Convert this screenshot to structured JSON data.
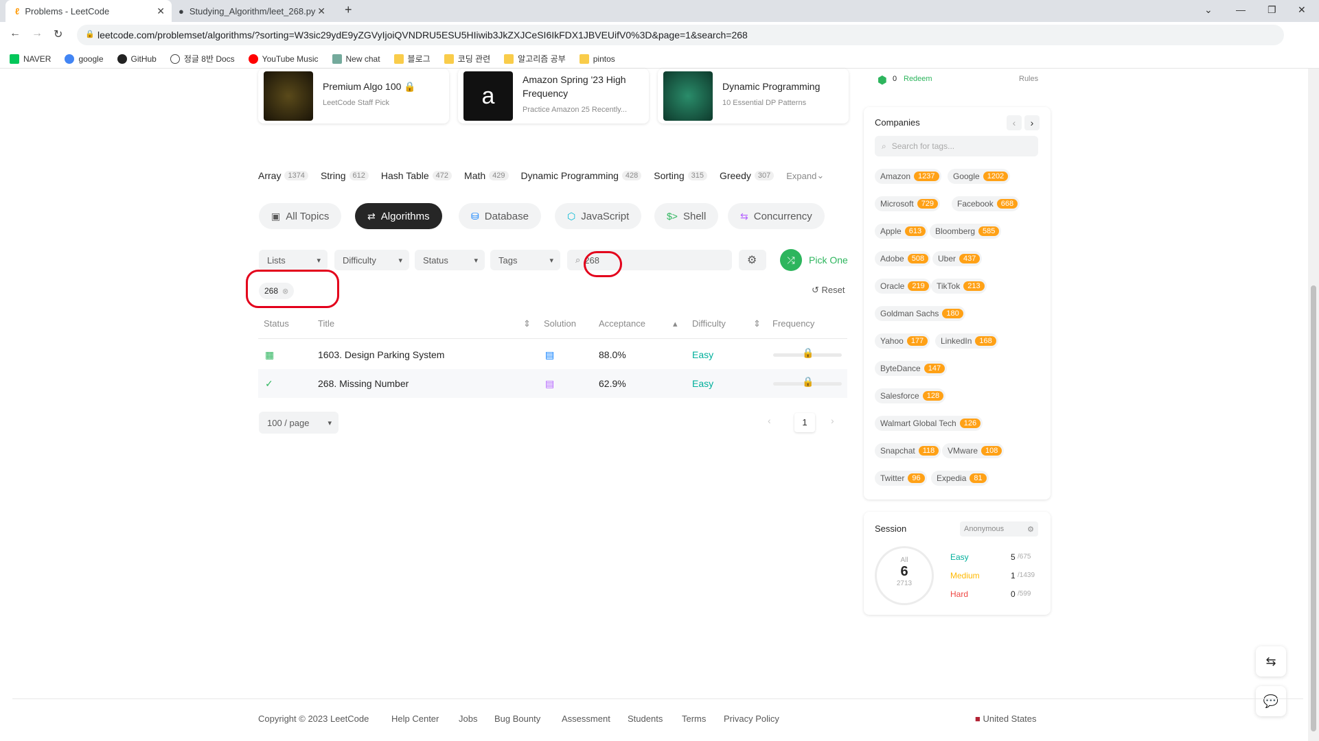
{
  "browser": {
    "tabs": [
      {
        "title": "Problems - LeetCode"
      },
      {
        "title": "Studying_Algorithm/leet_268.py"
      }
    ],
    "url": "leetcode.com/problemset/algorithms/?sorting=W3sic29ydE9yZGVyIjoiQVNDRU5ESU5HIiwib3JkZXJCeSI6IkFDX1JBVEUifV0%3D&page=1&search=268",
    "bookmarks": [
      "NAVER",
      "google",
      "GitHub",
      "정글 8반 Docs",
      "YouTube Music",
      "New chat",
      "블로그",
      "코딩 관련",
      "알고리즘 공부",
      "pintos"
    ]
  },
  "featured": [
    {
      "title": "Premium Algo 100",
      "sub": "LeetCode Staff Pick"
    },
    {
      "title": "Amazon Spring '23 High Frequency",
      "sub": "Practice Amazon 25 Recently..."
    },
    {
      "title": "Dynamic Programming",
      "sub": "10 Essential DP Patterns"
    }
  ],
  "topics": [
    {
      "name": "Array",
      "count": "1374"
    },
    {
      "name": "String",
      "count": "612"
    },
    {
      "name": "Hash Table",
      "count": "472"
    },
    {
      "name": "Math",
      "count": "429"
    },
    {
      "name": "Dynamic Programming",
      "count": "428"
    },
    {
      "name": "Sorting",
      "count": "315"
    },
    {
      "name": "Greedy",
      "count": "307"
    }
  ],
  "expand_label": "Expand",
  "categories": [
    "All Topics",
    "Algorithms",
    "Database",
    "JavaScript",
    "Shell",
    "Concurrency"
  ],
  "filters": {
    "lists": "Lists",
    "difficulty": "Difficulty",
    "status": "Status",
    "tags": "Tags",
    "search_value": "268",
    "pick_one": "Pick One",
    "chip": "268",
    "reset": "Reset"
  },
  "table": {
    "headers": [
      "Status",
      "Title",
      "Solution",
      "Acceptance",
      "Difficulty",
      "Frequency"
    ],
    "rows": [
      {
        "title": "1603. Design Parking System",
        "acceptance": "88.0%",
        "difficulty": "Easy"
      },
      {
        "title": "268. Missing Number",
        "acceptance": "62.9%",
        "difficulty": "Easy"
      }
    ]
  },
  "pagination": {
    "per_page": "100 / page",
    "page": "1"
  },
  "redeem": {
    "coins": "0",
    "label": "Redeem",
    "rules": "Rules"
  },
  "companies": {
    "title": "Companies",
    "search_placeholder": "Search for tags...",
    "items": [
      {
        "name": "Amazon",
        "count": "1237"
      },
      {
        "name": "Google",
        "count": "1202"
      },
      {
        "name": "Microsoft",
        "count": "729"
      },
      {
        "name": "Facebook",
        "count": "668"
      },
      {
        "name": "Apple",
        "count": "613"
      },
      {
        "name": "Bloomberg",
        "count": "585"
      },
      {
        "name": "Adobe",
        "count": "508"
      },
      {
        "name": "Uber",
        "count": "437"
      },
      {
        "name": "Oracle",
        "count": "219"
      },
      {
        "name": "TikTok",
        "count": "213"
      },
      {
        "name": "Goldman Sachs",
        "count": "180"
      },
      {
        "name": "Yahoo",
        "count": "177"
      },
      {
        "name": "LinkedIn",
        "count": "168"
      },
      {
        "name": "ByteDance",
        "count": "147"
      },
      {
        "name": "Salesforce",
        "count": "128"
      },
      {
        "name": "Walmart Global Tech",
        "count": "126"
      },
      {
        "name": "Snapchat",
        "count": "118"
      },
      {
        "name": "VMware",
        "count": "108"
      },
      {
        "name": "Twitter",
        "count": "96"
      },
      {
        "name": "Expedia",
        "count": "81"
      }
    ]
  },
  "session": {
    "title": "Session",
    "name": "Anonymous",
    "all_label": "All",
    "solved": "6",
    "total": "2713",
    "easy": {
      "label": "Easy",
      "solved": "5",
      "total": "/675"
    },
    "medium": {
      "label": "Medium",
      "solved": "1",
      "total": "/1439"
    },
    "hard": {
      "label": "Hard",
      "solved": "0",
      "total": "/599"
    }
  },
  "footer": {
    "copyright": "Copyright © 2023 LeetCode",
    "links": [
      "Help Center",
      "Jobs",
      "Bug Bounty",
      "Assessment",
      "Students",
      "Terms",
      "Privacy Policy"
    ],
    "region": "United States"
  }
}
